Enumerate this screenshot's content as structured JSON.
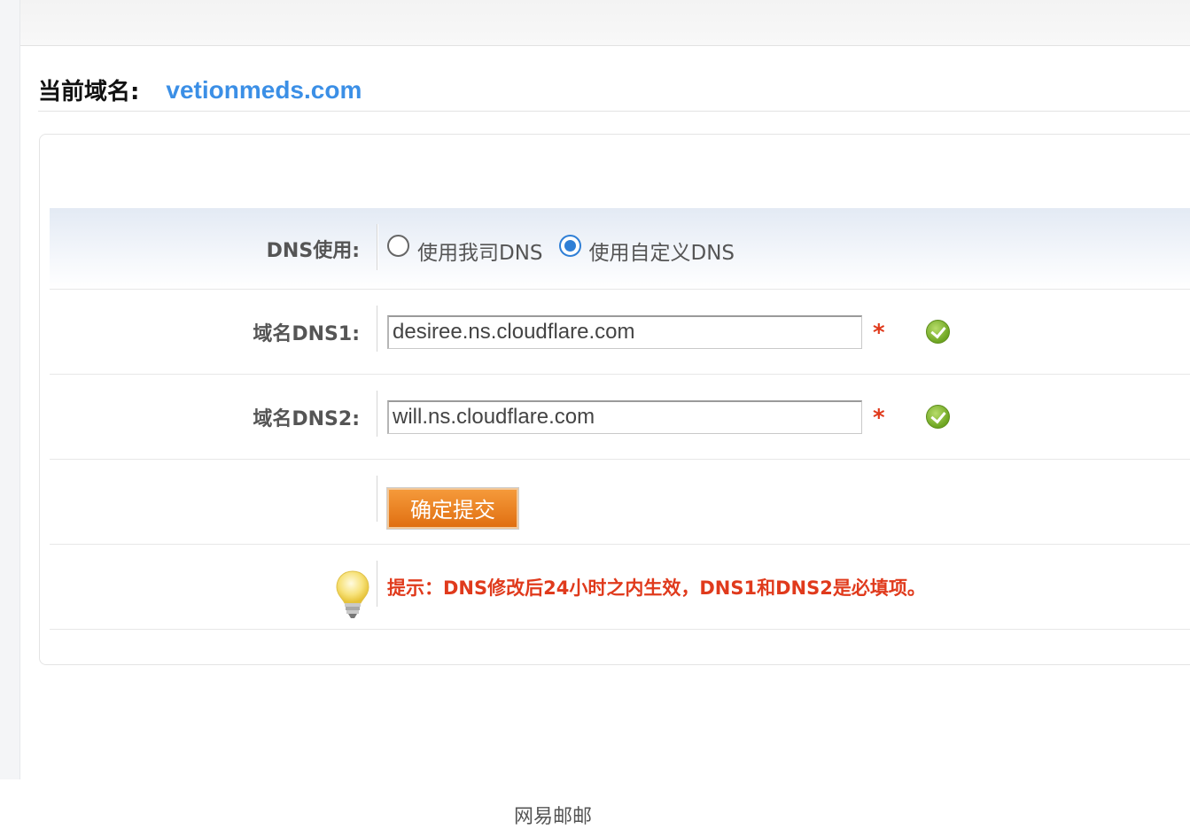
{
  "domain": {
    "label": "当前域名:",
    "value": "vetionmeds.com"
  },
  "form": {
    "dns_use": {
      "label": "DNS使用:",
      "options": [
        {
          "label": "使用我司DNS",
          "checked": false
        },
        {
          "label": "使用自定义DNS",
          "checked": true
        }
      ]
    },
    "dns1": {
      "label": "域名DNS1:",
      "value": "desiree.ns.cloudflare.com",
      "required_mark": "*",
      "status_icon": "check-circle-icon"
    },
    "dns2": {
      "label": "域名DNS2:",
      "value": "will.ns.cloudflare.com",
      "required_mark": "*",
      "status_icon": "check-circle-icon"
    },
    "submit_label": "确定提交",
    "tip": "提示：DNS修改后24小时之内生效，DNS1和DNS2是必填项。",
    "tip_icon": "lightbulb-icon"
  },
  "footer": {
    "text": "网易邮邮"
  },
  "colors": {
    "domain_value": "#3b8fe6",
    "required": "#e03a1c",
    "radio_checked": "#2f7fd6",
    "submit_button": "#e97f1f",
    "tip_text": "#e03a1c"
  }
}
